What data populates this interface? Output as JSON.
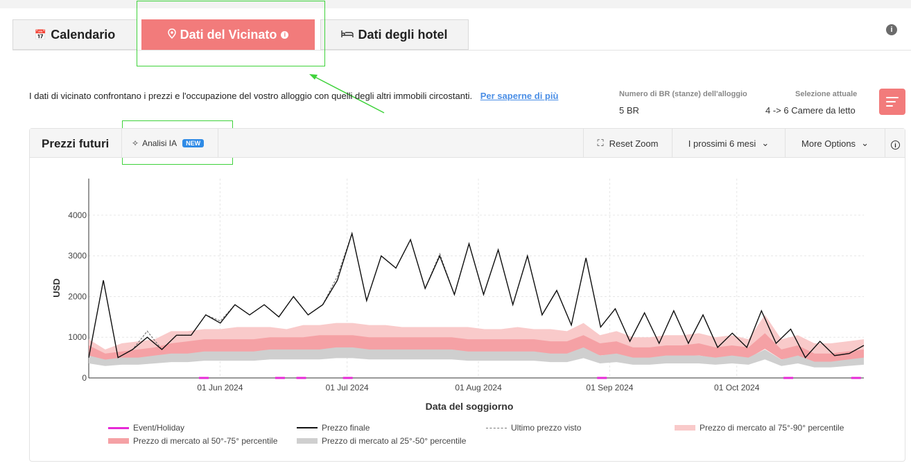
{
  "tabs": [
    {
      "label": "Calendario",
      "icon": "calendar-icon"
    },
    {
      "label": "Dati del Vicinato",
      "icon": "location-pin-icon"
    },
    {
      "label": "Dati degli hotel",
      "icon": "bed-icon"
    }
  ],
  "description": {
    "text": "I dati di vicinato confrontano i prezzi e l'occupazione del vostro alloggio con quelli degli altri immobili circostanti.",
    "link": "Per saperne di più"
  },
  "property_meta": {
    "br_label": "Numero di BR (stanze) dell'alloggio",
    "br_value": "5 BR",
    "selection_label": "Selezione attuale",
    "selection_value": "4 -> 6 Camere da letto"
  },
  "panel": {
    "title": "Prezzi futuri",
    "ai_label": "Analisi IA",
    "ai_badge": "NEW",
    "reset_zoom": "Reset Zoom",
    "period": "I prossimi 6 mesi",
    "more_options": "More Options"
  },
  "colors": {
    "accent": "#f27b7b",
    "p75_90": "#f9caca",
    "p50_75": "#f5a1a5",
    "p25_50": "#cfcfcf",
    "event": "#e629d6",
    "badge": "#2f8be6"
  },
  "chart_data": {
    "type": "line",
    "xlabel": "Data del soggiorno",
    "ylabel": "USD",
    "ylim": [
      0,
      4900
    ],
    "yticks": [
      "0",
      "1000",
      "2000",
      "3000",
      "4000"
    ],
    "xticks": [
      "01 Jun 2024",
      "01 Jul 2024",
      "01 Aug 2024",
      "01 Sep 2024",
      "01 Oct 2024"
    ],
    "grid": true,
    "legend_position": "bottom",
    "x": [
      "2024-05-03",
      "2024-05-06",
      "2024-05-10",
      "2024-05-14",
      "2024-05-18",
      "2024-05-22",
      "2024-05-26",
      "2024-05-30",
      "2024-06-03",
      "2024-06-07",
      "2024-06-11",
      "2024-06-15",
      "2024-06-19",
      "2024-06-23",
      "2024-06-27",
      "2024-07-01",
      "2024-07-05",
      "2024-07-09",
      "2024-07-13",
      "2024-07-17",
      "2024-07-21",
      "2024-07-25",
      "2024-07-29",
      "2024-08-02",
      "2024-08-06",
      "2024-08-10",
      "2024-08-14",
      "2024-08-18",
      "2024-08-22",
      "2024-08-26",
      "2024-08-30",
      "2024-09-03",
      "2024-09-07",
      "2024-09-11",
      "2024-09-15",
      "2024-09-19",
      "2024-09-23",
      "2024-09-27",
      "2024-10-01",
      "2024-10-05",
      "2024-10-09",
      "2024-10-13",
      "2024-10-17",
      "2024-10-21",
      "2024-10-25",
      "2024-10-29"
    ],
    "series": [
      {
        "name": "Prezzo finale",
        "values": [
          500,
          2400,
          500,
          700,
          1000,
          700,
          1050,
          1050,
          1550,
          1350,
          1800,
          1550,
          1800,
          1500,
          2000,
          1550,
          1800,
          2400,
          3550,
          1900,
          3000,
          2700,
          3400,
          2200,
          3000,
          2050,
          3300,
          2050,
          3150,
          1800,
          3000,
          1550,
          2150,
          1300,
          2950,
          1250,
          1700,
          900,
          1600,
          850,
          1650,
          850,
          1550,
          750,
          1100,
          750,
          1650,
          850,
          1200,
          500,
          900,
          550,
          600,
          800
        ],
        "note_values_count_matches_x_resampled": ""
      },
      {
        "name": "Ultimo prezzo visto",
        "values": [
          500,
          2400,
          500,
          700,
          1150,
          700,
          1050,
          1050,
          1550,
          1400,
          1800,
          1550,
          1800,
          1500,
          2000,
          1550,
          1800,
          2500,
          3550,
          1900,
          3000,
          2700,
          3400,
          2200,
          3050,
          2050,
          3300,
          2050,
          3150,
          1800,
          3000,
          1550,
          2150,
          1300,
          2950,
          1250,
          1700,
          900,
          1600,
          850,
          1650,
          850,
          1550,
          750,
          1100,
          750,
          1650,
          850,
          1200,
          500,
          900,
          550,
          600,
          800
        ]
      },
      {
        "name": "Prezzo di mercato al 75°-90° percentile",
        "values": [
          950,
          700,
          850,
          900,
          950,
          1150,
          1150,
          1200,
          1200,
          1250,
          1250,
          1250,
          1200,
          1300,
          1300,
          1350,
          1350,
          1300,
          1300,
          1250,
          1250,
          1250,
          1250,
          1250,
          1200,
          1200,
          1250,
          1200,
          1200,
          1150,
          1350,
          1050,
          1150,
          1000,
          1000,
          1050,
          1050,
          1100,
          1000,
          1050,
          950,
          1550,
          950,
          1050,
          850,
          850,
          900,
          950
        ]
      },
      {
        "name": "Prezzo di mercato al 50°-75° percentile",
        "values": [
          800,
          600,
          650,
          700,
          750,
          850,
          900,
          950,
          950,
          950,
          950,
          1000,
          1000,
          1000,
          1050,
          1050,
          1050,
          1000,
          1000,
          1000,
          1000,
          1000,
          1000,
          950,
          950,
          950,
          950,
          950,
          900,
          900,
          1050,
          850,
          900,
          750,
          750,
          800,
          800,
          850,
          750,
          800,
          750,
          1100,
          700,
          800,
          600,
          600,
          650,
          700
        ]
      },
      {
        "name": "Prezzo di mercato al 25°-50° percentile",
        "values": [
          550,
          450,
          500,
          500,
          550,
          600,
          600,
          650,
          650,
          650,
          650,
          700,
          700,
          700,
          700,
          750,
          750,
          700,
          700,
          700,
          700,
          700,
          700,
          650,
          650,
          650,
          650,
          650,
          600,
          600,
          750,
          550,
          600,
          500,
          500,
          550,
          550,
          550,
          500,
          550,
          500,
          700,
          450,
          550,
          400,
          400,
          450,
          500
        ]
      }
    ],
    "events": [
      "2024-05-28",
      "2024-06-15",
      "2024-06-20",
      "2024-07-01",
      "2024-08-30",
      "2024-10-13",
      "2024-10-29"
    ],
    "legend": [
      "Event/Holiday",
      "Prezzo finale",
      "Ultimo prezzo visto",
      "Prezzo di mercato al 75°-90° percentile",
      "Prezzo di mercato al 50°-75° percentile",
      "Prezzo di mercato al 25°-50° percentile"
    ]
  }
}
